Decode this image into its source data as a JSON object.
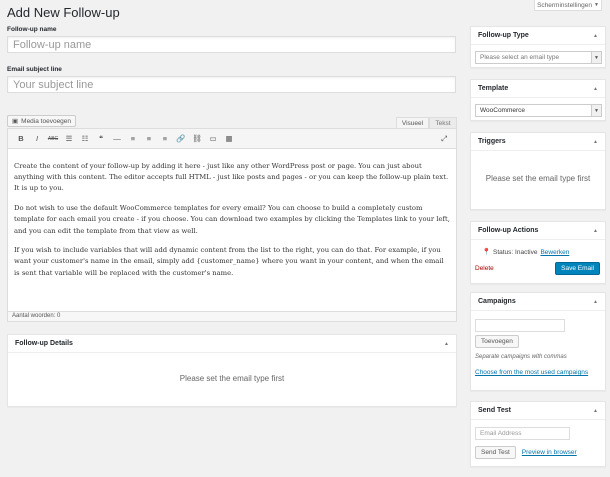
{
  "screen_options": {
    "label": "Scherminstellingen"
  },
  "page": {
    "title": "Add New Follow-up"
  },
  "form": {
    "name_label": "Follow-up name",
    "name_placeholder": "Follow-up name",
    "subject_label": "Email subject line",
    "subject_placeholder": "Your subject line"
  },
  "editor": {
    "media_button": "Media toevoegen",
    "tabs": {
      "visual": "Visueel",
      "text": "Tekst"
    },
    "toolbar": [
      {
        "name": "bold-button",
        "glyph": "B",
        "style": "bold"
      },
      {
        "name": "italic-button",
        "glyph": "I",
        "style": "italic"
      },
      {
        "name": "strikethrough-button",
        "glyph": "ABC",
        "style": "strike"
      },
      {
        "name": "bullet-list-button",
        "glyph": "☰",
        "style": ""
      },
      {
        "name": "numbered-list-button",
        "glyph": "☷",
        "style": ""
      },
      {
        "name": "blockquote-button",
        "glyph": "❝",
        "style": ""
      },
      {
        "name": "horizontal-rule-button",
        "glyph": "—",
        "style": ""
      },
      {
        "name": "align-left-button",
        "glyph": "≡",
        "style": ""
      },
      {
        "name": "align-center-button",
        "glyph": "≡",
        "style": ""
      },
      {
        "name": "align-right-button",
        "glyph": "≡",
        "style": ""
      },
      {
        "name": "insert-link-button",
        "glyph": "🔗",
        "style": ""
      },
      {
        "name": "remove-link-button",
        "glyph": "⛓",
        "style": ""
      },
      {
        "name": "read-more-button",
        "glyph": "▭",
        "style": ""
      },
      {
        "name": "toolbar-toggle-button",
        "glyph": "▦",
        "style": ""
      }
    ],
    "fullscreen_glyph": "⤢",
    "paragraphs": [
      "Create the content of your follow-up by adding it here - just like any other WordPress post or page. You can just about anything with this content. The editor accepts full HTML - just like posts and pages - or you can keep the follow-up plain text. It is up to you.",
      "Do not wish to use the default WooCommerce templates for every email? You can choose to build a completely custom template for each email you create - if you choose. You can download two examples by clicking the Templates link to your left, and you can edit the template from that view as well.",
      "If you wish to include variables that will add dynamic content from the list to the right, you can do that. For example, if you want your customer's name in the email, simply add {customer_name} where you want in your content, and when the email is sent that variable will be replaced with the customer's name."
    ],
    "word_count": "Aantal woorden: 0"
  },
  "details_box": {
    "title": "Follow-up Details",
    "message": "Please set the email type first"
  },
  "sidebar": {
    "type_box": {
      "title": "Follow-up Type",
      "select_value": "Please select an email type"
    },
    "template_box": {
      "title": "Template",
      "select_value": "WooCommerce"
    },
    "triggers_box": {
      "title": "Triggers",
      "message": "Please set the email type first"
    },
    "actions_box": {
      "title": "Follow-up Actions",
      "status_text": "Status: Inactive",
      "edit_link": "Bewerken",
      "delete_link": "Delete",
      "save_button": "Save Email"
    },
    "campaigns_box": {
      "title": "Campaigns",
      "add_button": "Toevoegen",
      "hint": "Separate campaigns with commas",
      "choose_link": "Choose from the most used campaigns"
    },
    "send_test_box": {
      "title": "Send Test",
      "email_placeholder": "Email Address",
      "send_button": "Send Test",
      "preview_link": "Preview in browser"
    }
  }
}
